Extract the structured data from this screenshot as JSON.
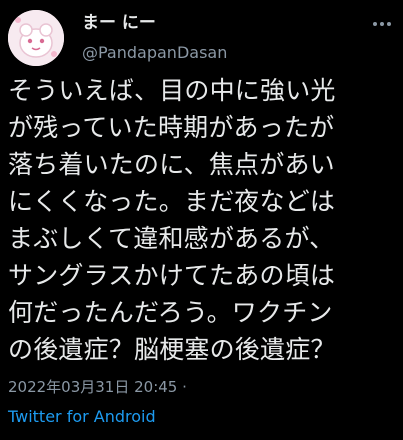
{
  "author": {
    "display_name": "まー にー",
    "handle": "@PandapanDasan"
  },
  "icons": {
    "avatar": "avatar",
    "more": "more-horizontal-icon"
  },
  "tweet": {
    "text": "そういえば、目の中に強い光\nが残っていた時期があったが\n落ち着いたのに、焦点があい\nにくくなった。まだ夜などは\nまぶしくて違和感があるが、\nサングラスかけてたあの頃は\n何だったんだろう。ワクチン\nの後遺症？脳梗塞の後遺症？"
  },
  "meta": {
    "timestamp": "2022年03月31日 20:45 ·",
    "source": "Twitter for Android"
  },
  "colors": {
    "background": "#000000",
    "text": "#e7e9ea",
    "muted": "#8b98a5",
    "link": "#1d9bf0"
  }
}
